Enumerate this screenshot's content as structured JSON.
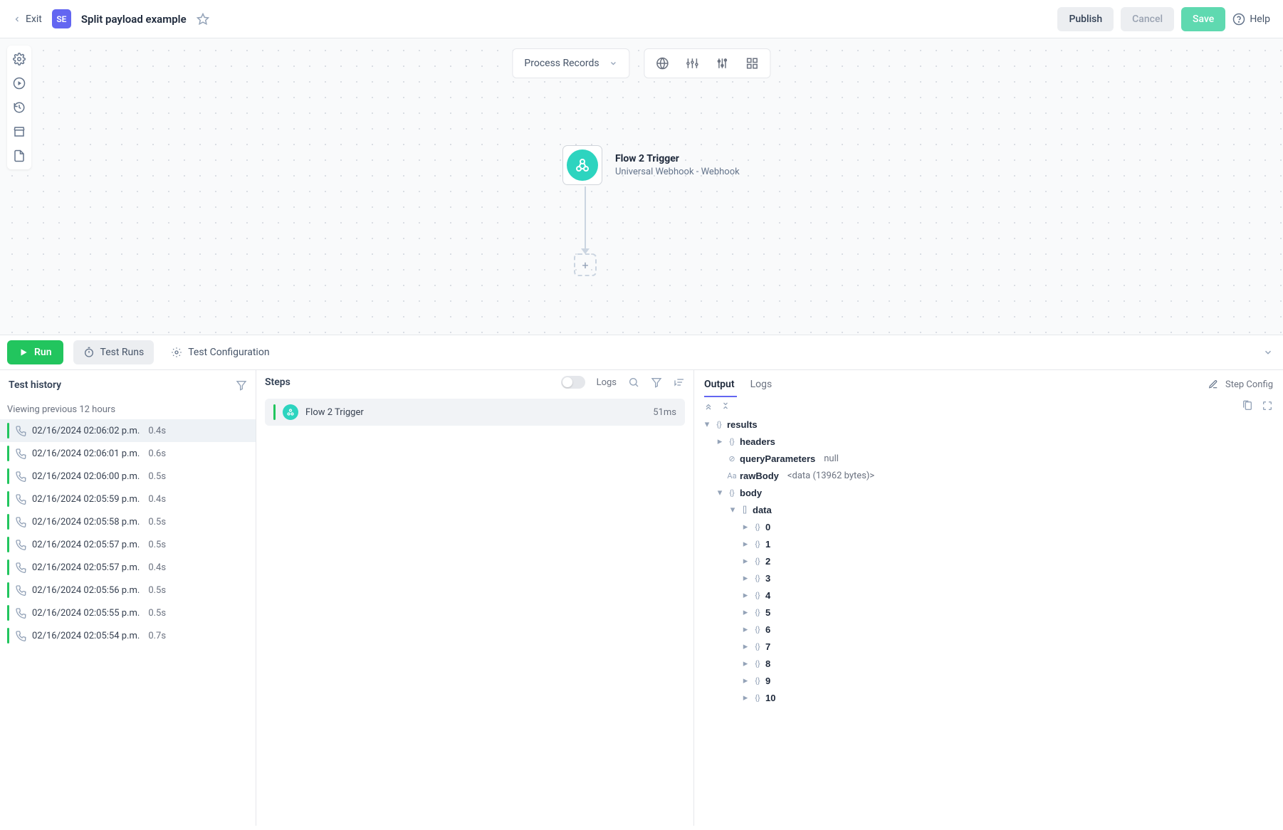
{
  "header": {
    "exit": "Exit",
    "badge": "SE",
    "title": "Split payload example",
    "publish": "Publish",
    "cancel": "Cancel",
    "save": "Save",
    "help": "Help"
  },
  "canvas": {
    "dropdown": "Process Records",
    "trigger": {
      "title": "Flow 2 Trigger",
      "subtitle": "Universal Webhook - Webhook"
    }
  },
  "runbar": {
    "run": "Run",
    "testRuns": "Test Runs",
    "testConfig": "Test Configuration"
  },
  "history": {
    "title": "Test history",
    "subtitle": "Viewing previous 12 hours",
    "items": [
      {
        "time": "02/16/2024 02:06:02 p.m.",
        "dur": "0.4s"
      },
      {
        "time": "02/16/2024 02:06:01 p.m.",
        "dur": "0.6s"
      },
      {
        "time": "02/16/2024 02:06:00 p.m.",
        "dur": "0.5s"
      },
      {
        "time": "02/16/2024 02:05:59 p.m.",
        "dur": "0.4s"
      },
      {
        "time": "02/16/2024 02:05:58 p.m.",
        "dur": "0.5s"
      },
      {
        "time": "02/16/2024 02:05:57 p.m.",
        "dur": "0.5s"
      },
      {
        "time": "02/16/2024 02:05:57 p.m.",
        "dur": "0.4s"
      },
      {
        "time": "02/16/2024 02:05:56 p.m.",
        "dur": "0.5s"
      },
      {
        "time": "02/16/2024 02:05:55 p.m.",
        "dur": "0.5s"
      },
      {
        "time": "02/16/2024 02:05:54 p.m.",
        "dur": "0.7s"
      }
    ]
  },
  "steps": {
    "title": "Steps",
    "logsLabel": "Logs",
    "step1": {
      "name": "Flow 2 Trigger",
      "timing": "51ms"
    }
  },
  "output": {
    "tabOutput": "Output",
    "tabLogs": "Logs",
    "stepConfig": "Step Config",
    "tree": {
      "results": "results",
      "headers": "headers",
      "queryParameters": "queryParameters",
      "queryParametersVal": "null",
      "rawBody": "rawBody",
      "rawBodyVal": "<data (13962 bytes)>",
      "body": "body",
      "data": "data",
      "items": [
        "0",
        "1",
        "2",
        "3",
        "4",
        "5",
        "6",
        "7",
        "8",
        "9",
        "10"
      ]
    }
  }
}
